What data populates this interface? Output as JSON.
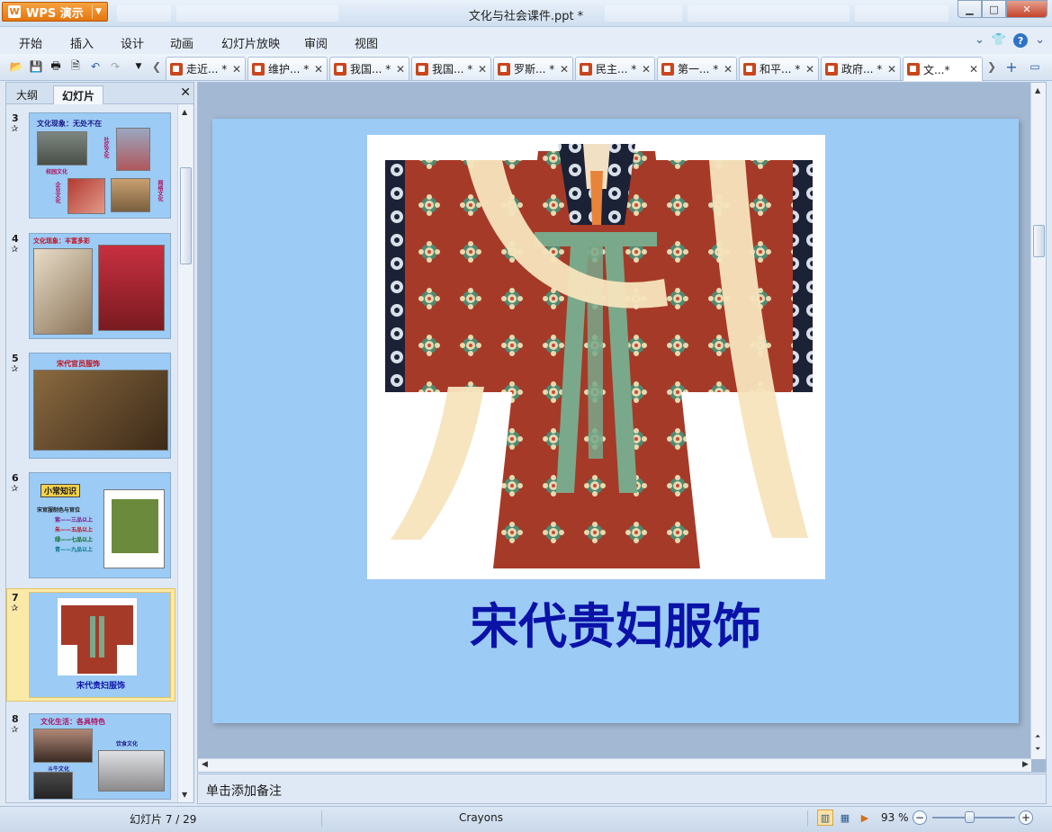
{
  "app": {
    "menu_button_label": "WPS 演示",
    "document_title": "文化与社会课件.ppt *"
  },
  "menu": [
    "开始",
    "插入",
    "设计",
    "动画",
    "幻灯片放映",
    "审阅",
    "视图"
  ],
  "doc_tabs": [
    {
      "label": "走近... *"
    },
    {
      "label": "维护... *"
    },
    {
      "label": "我国... *"
    },
    {
      "label": "我国... *"
    },
    {
      "label": "罗斯... *"
    },
    {
      "label": "民主... *"
    },
    {
      "label": "第一... *"
    },
    {
      "label": "和平... *"
    },
    {
      "label": "政府... *"
    },
    {
      "label": "文...*",
      "active": true
    }
  ],
  "left_pane": {
    "tab_outline": "大纲",
    "tab_slides": "幻灯片",
    "slides": [
      {
        "number": "3",
        "title": "文化现象：无处不在",
        "captions": [
          "校园文化",
          "社区文化",
          "企业文化",
          "网络文化"
        ]
      },
      {
        "number": "4",
        "title": "文化现象：丰富多彩"
      },
      {
        "number": "5",
        "title": "宋代官员服饰"
      },
      {
        "number": "6",
        "title": "小常知识",
        "lines": [
          "宋官服制色与官位",
          "紫——三品以上",
          "朱——五品以上",
          "绿——七品以上",
          "青——九品以上"
        ]
      },
      {
        "number": "7",
        "title": "宋代贵妇服饰",
        "selected": true
      },
      {
        "number": "8",
        "title": "文化生活：各具特色",
        "captions": [
          "斗牛文化",
          "饮食文化"
        ]
      }
    ]
  },
  "slide": {
    "title": "宋代贵妇服饰"
  },
  "notes_placeholder": "单击添加备注",
  "status": {
    "slide_counter": "幻灯片 7 / 29",
    "theme_name": "Crayons",
    "zoom": "93 %"
  },
  "colors": {
    "slide_bg": "#9ccbf5",
    "title_color": "#0a12a8",
    "robe_red": "#a63a28",
    "sash_green": "#7aa88a"
  }
}
